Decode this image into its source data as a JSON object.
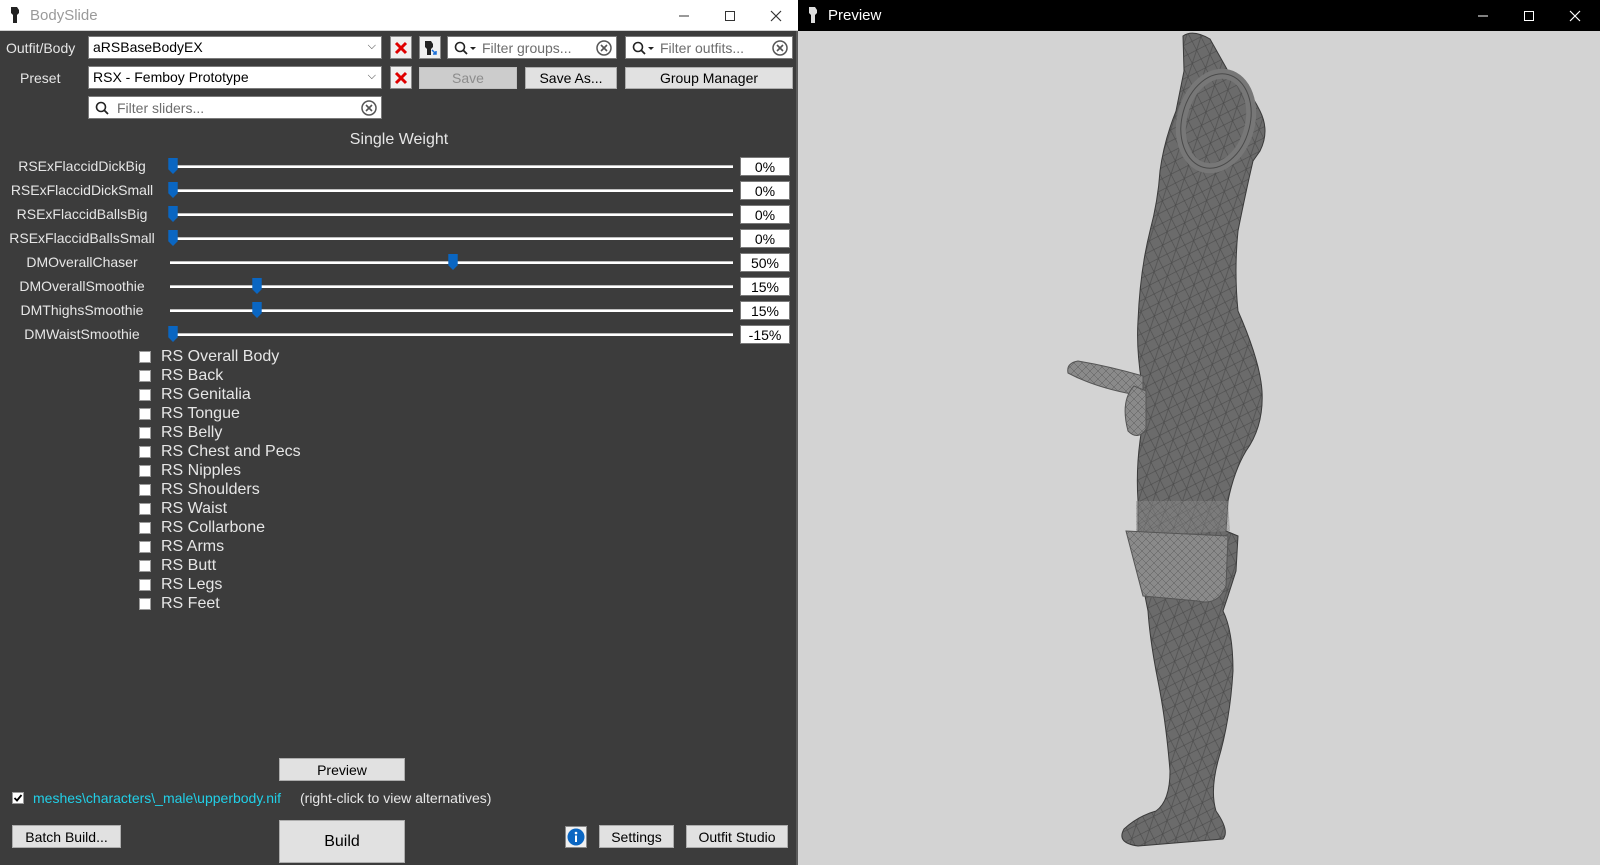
{
  "bodyslide": {
    "title": "BodySlide",
    "outfit_label": "Outfit/Body",
    "outfit_value": "aRSBaseBodyEX",
    "preset_label": "Preset",
    "preset_value": "RSX - Femboy Prototype",
    "filter_groups_placeholder": "Filter groups...",
    "filter_outfits_placeholder": "Filter outfits...",
    "filter_sliders_placeholder": "Filter sliders...",
    "save_label": "Save",
    "save_as_label": "Save As...",
    "group_manager_label": "Group Manager",
    "section_title": "Single Weight",
    "sliders": [
      {
        "name": "RSExFlaccidDickBig",
        "value": 0,
        "display": "0%"
      },
      {
        "name": "RSExFlaccidDickSmall",
        "value": 0,
        "display": "0%"
      },
      {
        "name": "RSExFlaccidBallsBig",
        "value": 0,
        "display": "0%"
      },
      {
        "name": "RSExFlaccidBallsSmall",
        "value": 0,
        "display": "0%"
      },
      {
        "name": "DMOverallChaser",
        "value": 50,
        "display": "50%"
      },
      {
        "name": "DMOverallSmoothie",
        "value": 15,
        "display": "15%"
      },
      {
        "name": "DMThighsSmoothie",
        "value": 15,
        "display": "15%"
      },
      {
        "name": "DMWaistSmoothie",
        "value": -15,
        "display": "-15%"
      }
    ],
    "groups": [
      "RS Overall Body",
      "RS Back",
      "RS Genitalia",
      "RS Tongue",
      "RS Belly",
      "RS Chest and Pecs",
      "RS Nipples",
      "RS Shoulders",
      "RS Waist",
      "RS Collarbone",
      "RS Arms",
      "RS Butt",
      "RS Legs",
      "RS Feet"
    ],
    "preview_label": "Preview",
    "output_path": "meshes\\characters\\_male\\upperbody.nif",
    "output_hint": "(right-click to view alternatives)",
    "output_checked": true,
    "batch_build_label": "Batch Build...",
    "build_label": "Build",
    "settings_label": "Settings",
    "outfit_studio_label": "Outfit Studio"
  },
  "preview": {
    "title": "Preview"
  },
  "colors": {
    "accent": "#0a66c2",
    "link": "#21d0e8",
    "panel": "#3c3c3c",
    "clear_x": "#e00000"
  }
}
